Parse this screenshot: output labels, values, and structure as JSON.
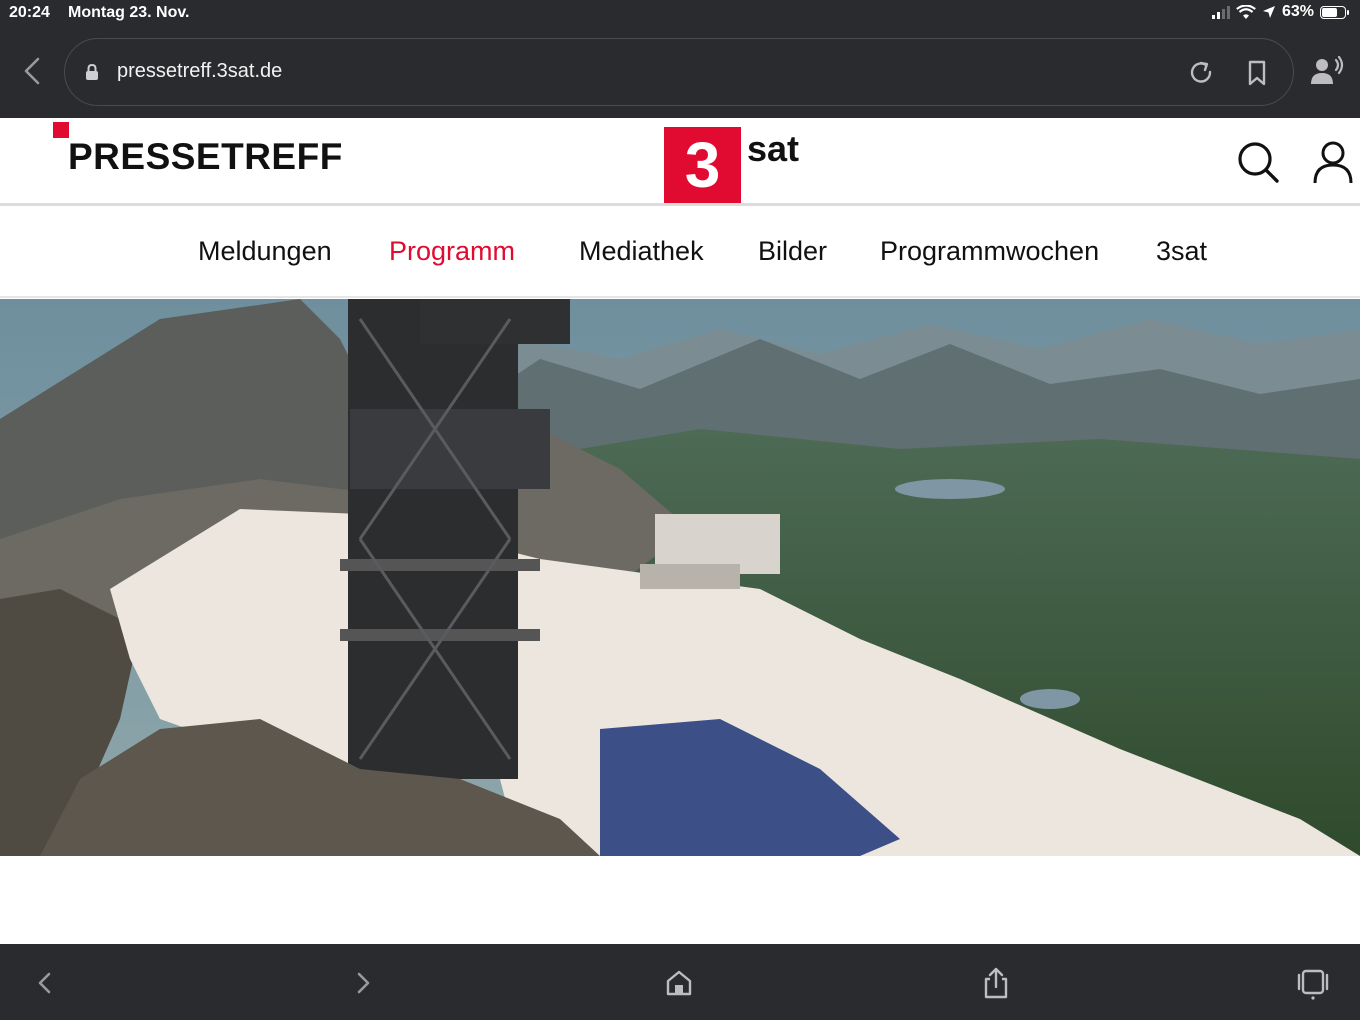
{
  "status_bar": {
    "time": "20:24",
    "date": "Montag 23. Nov.",
    "battery": "63%",
    "battery_level": 0.63
  },
  "browser": {
    "url": "pressetreff.3sat.de",
    "icons": [
      "back-icon",
      "lock-icon",
      "reload-icon",
      "bookmark-icon",
      "speaker-icon"
    ]
  },
  "site": {
    "brand": "PRESSETREFF",
    "logo_number": "3",
    "logo_text": "sat",
    "accent_color": "#e10a30"
  },
  "nav": {
    "items": [
      {
        "label": "Meldungen"
      },
      {
        "label": "Programm",
        "active": true
      },
      {
        "label": "Mediathek"
      },
      {
        "label": "Bilder"
      },
      {
        "label": "Programmwochen"
      },
      {
        "label": "3sat"
      }
    ]
  },
  "hero": {
    "icon": "mountain-summit-photo"
  },
  "toolbar": {
    "icons": [
      "back-icon",
      "forward-icon",
      "home-icon",
      "share-icon",
      "tabs-icon"
    ]
  }
}
